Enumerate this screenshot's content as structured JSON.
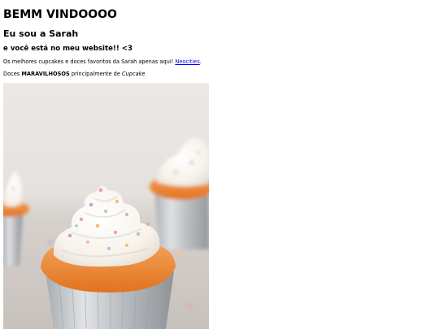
{
  "heading": "BEMM VINDOOOO",
  "subheading": "Eu sou a Sarah",
  "tagline": "e você está no meu website!! <3",
  "intro": {
    "text_before": "Os melhores cupcakes e doces favoritos da Sarah apenas aqui! ",
    "link_label": "Neocities",
    "text_after": "."
  },
  "sweets_line": {
    "prefix": "Doces ",
    "bold": "MARAVILHOSOS",
    "middle": " principalmente de ",
    "italic": "Cupcake"
  },
  "image": {
    "subject": "cupcake-photo",
    "colors": {
      "background": "#e9e6e3",
      "table": "#cfcac6",
      "cake": "#f08a3a",
      "frosting": "#fbf8f2",
      "liner": "#c9ccd0"
    }
  },
  "colors": {
    "link": "#0000ee",
    "text": "#000000",
    "background": "#ffffff"
  }
}
